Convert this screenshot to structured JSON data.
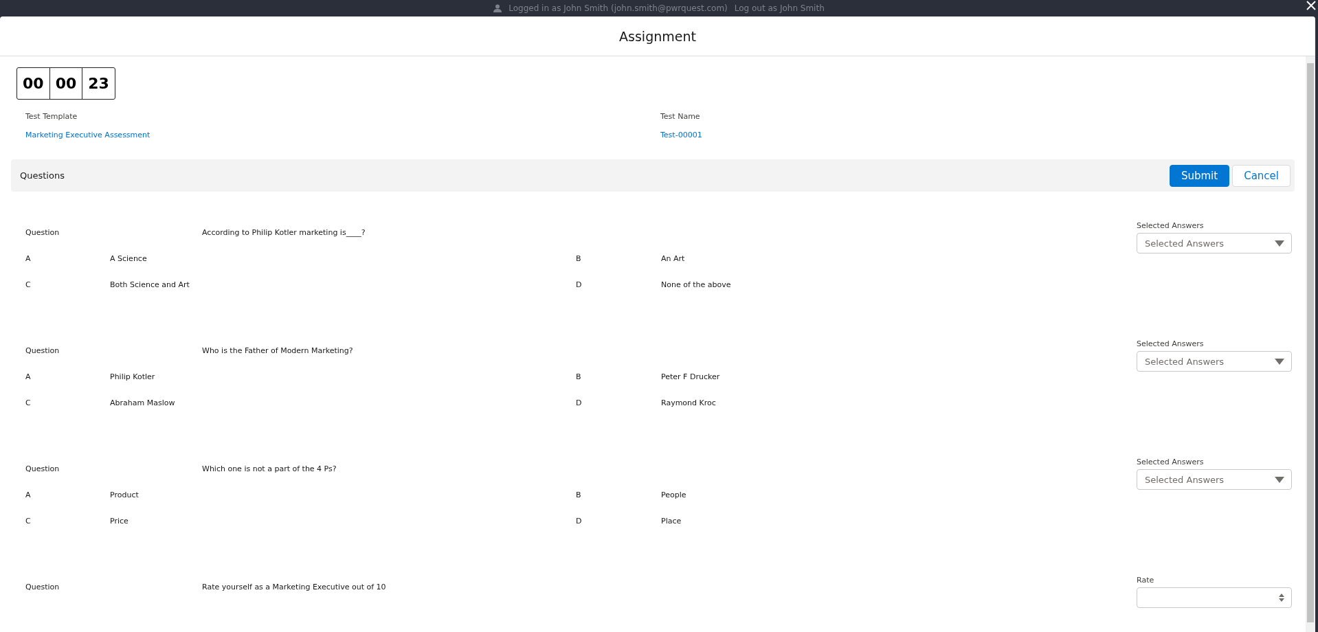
{
  "top_bar": {
    "login_text": "Logged in as John Smith (john.smith@pwrquest.com)",
    "logout_link": "Log out as John Smith"
  },
  "modal": {
    "title": "Assignment"
  },
  "timer": [
    "00",
    "00",
    "23"
  ],
  "fields": [
    {
      "label": "Test Template",
      "value": "Marketing Executive Assessment"
    },
    {
      "label": "Test Name",
      "value": "Test-00001"
    }
  ],
  "questions_bar": {
    "title": "Questions",
    "buttons": [
      {
        "label": "Submit",
        "kind": "primary"
      },
      {
        "label": "Cancel",
        "kind": "neutral"
      }
    ]
  },
  "questions": [
    {
      "label": "Question",
      "text": "According to Philip Kotler marketing is____?",
      "answer_label": "Selected Answers",
      "kind": "picklist",
      "answer_placeholder": "Selected Answers",
      "options": [
        {
          "letter": "A",
          "text": "A Science"
        },
        {
          "letter": "B",
          "text": "An Art"
        },
        {
          "letter": "C",
          "text": "Both Science and Art"
        },
        {
          "letter": "D",
          "text": "None of the above"
        }
      ]
    },
    {
      "label": "Question",
      "text": "Who is the Father of Modern Marketing?",
      "answer_label": "Selected Answers",
      "kind": "picklist",
      "answer_placeholder": "Selected Answers",
      "options": [
        {
          "letter": "A",
          "text": "Philip Kotler"
        },
        {
          "letter": "B",
          "text": "Peter F Drucker"
        },
        {
          "letter": "C",
          "text": "Abraham Maslow"
        },
        {
          "letter": "D",
          "text": "Raymond Kroc"
        }
      ]
    },
    {
      "label": "Question",
      "text": "Which one is not a part of the 4 Ps?",
      "answer_label": "Selected Answers",
      "kind": "picklist",
      "answer_placeholder": "Selected Answers",
      "options": [
        {
          "letter": "A",
          "text": "Product"
        },
        {
          "letter": "B",
          "text": "People"
        },
        {
          "letter": "C",
          "text": "Price"
        },
        {
          "letter": "D",
          "text": "Place"
        }
      ]
    },
    {
      "label": "Question",
      "text": "Rate yourself as a Marketing Executive out of 10",
      "answer_label": "Rate",
      "kind": "number"
    }
  ]
}
